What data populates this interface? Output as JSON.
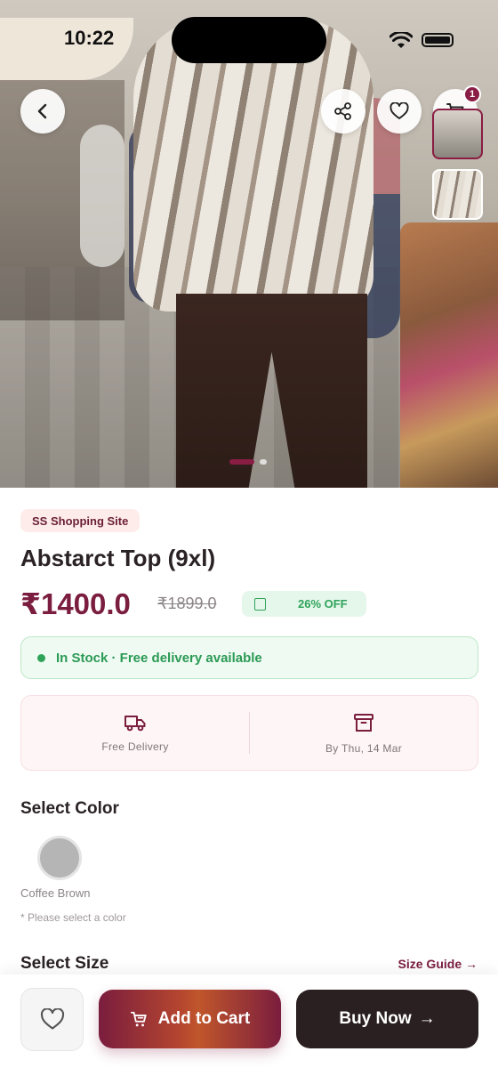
{
  "status_bar": {
    "time": "10:22"
  },
  "product": {
    "shop": "SS Shopping Site",
    "title": "Abstarct Top (9xl)",
    "price": "₹1400.0",
    "mrp": "₹1899.0",
    "discount": "26% OFF"
  },
  "header": {
    "cart_count": "1"
  },
  "stock": {
    "text": "In Stock · Free delivery available"
  },
  "delivery": {
    "left_label": "Free Delivery",
    "right_label": "By Thu, 14 Mar"
  },
  "color_section": {
    "title": "Select Color",
    "selected_name": "Coffee Brown",
    "swatch_color": "#b5b5b5",
    "hint": "* Please select a color"
  },
  "size_section": {
    "title": "Select Size",
    "guide_label": "Size Guide →"
  },
  "actions": {
    "add_to_cart": "Add to Cart",
    "buy_now": "Buy Now"
  },
  "colors": {
    "brand": "#7a1d3e",
    "success": "#2fa35a",
    "dark": "#2b2021"
  },
  "icons": [
    "back-icon",
    "share-icon",
    "heart-icon",
    "cart-icon",
    "truck-icon",
    "box-icon",
    "wifi-icon",
    "battery-icon"
  ]
}
